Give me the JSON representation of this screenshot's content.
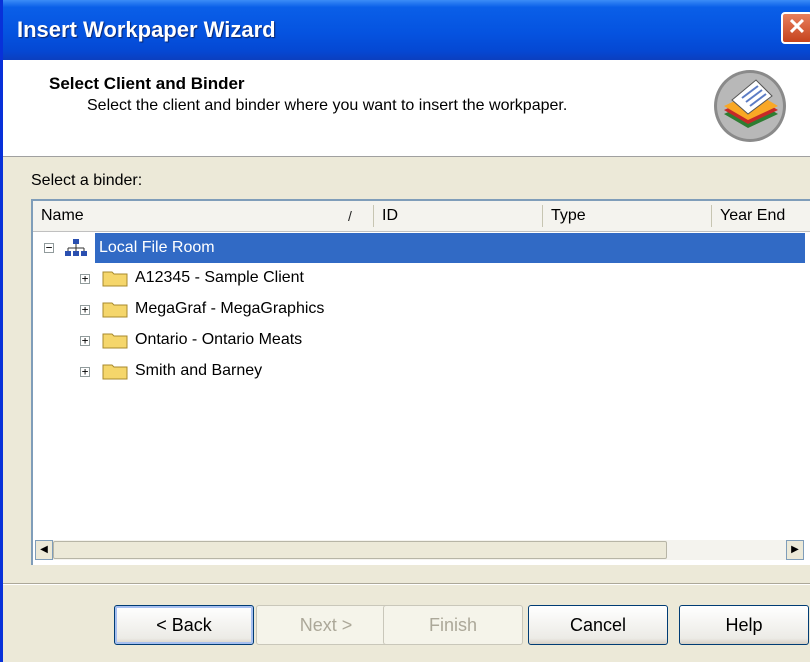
{
  "window": {
    "title": "Insert Workpaper Wizard",
    "close_glyph": "✕"
  },
  "header": {
    "title": "Select Client and Binder",
    "subtitle": "Select the client and binder where you want to insert the workpaper.",
    "icon": "binder-wizard-icon"
  },
  "list": {
    "label": "Select a binder:",
    "columns": [
      "Name",
      "ID",
      "Type",
      "Year End"
    ],
    "sort_indicator": "/",
    "root": {
      "label": "Local File Room",
      "icon": "network-tree-icon",
      "expander": "−",
      "selected": true
    },
    "items": [
      {
        "label": "A12345 - Sample Client",
        "expander": "+"
      },
      {
        "label": "MegaGraf - MegaGraphics",
        "expander": "+"
      },
      {
        "label": "Ontario - Ontario Meats",
        "expander": "+"
      },
      {
        "label": "Smith and Barney",
        "expander": "+"
      }
    ]
  },
  "scrollbar": {
    "left_arrow": "◀",
    "right_arrow": "▶"
  },
  "buttons": {
    "back": "< Back",
    "next": "Next >",
    "finish": "Finish",
    "cancel": "Cancel",
    "help": "Help"
  },
  "colors": {
    "selection": "#316ac5",
    "titlebar": "#0553e0",
    "folder": "#f5d66b"
  }
}
